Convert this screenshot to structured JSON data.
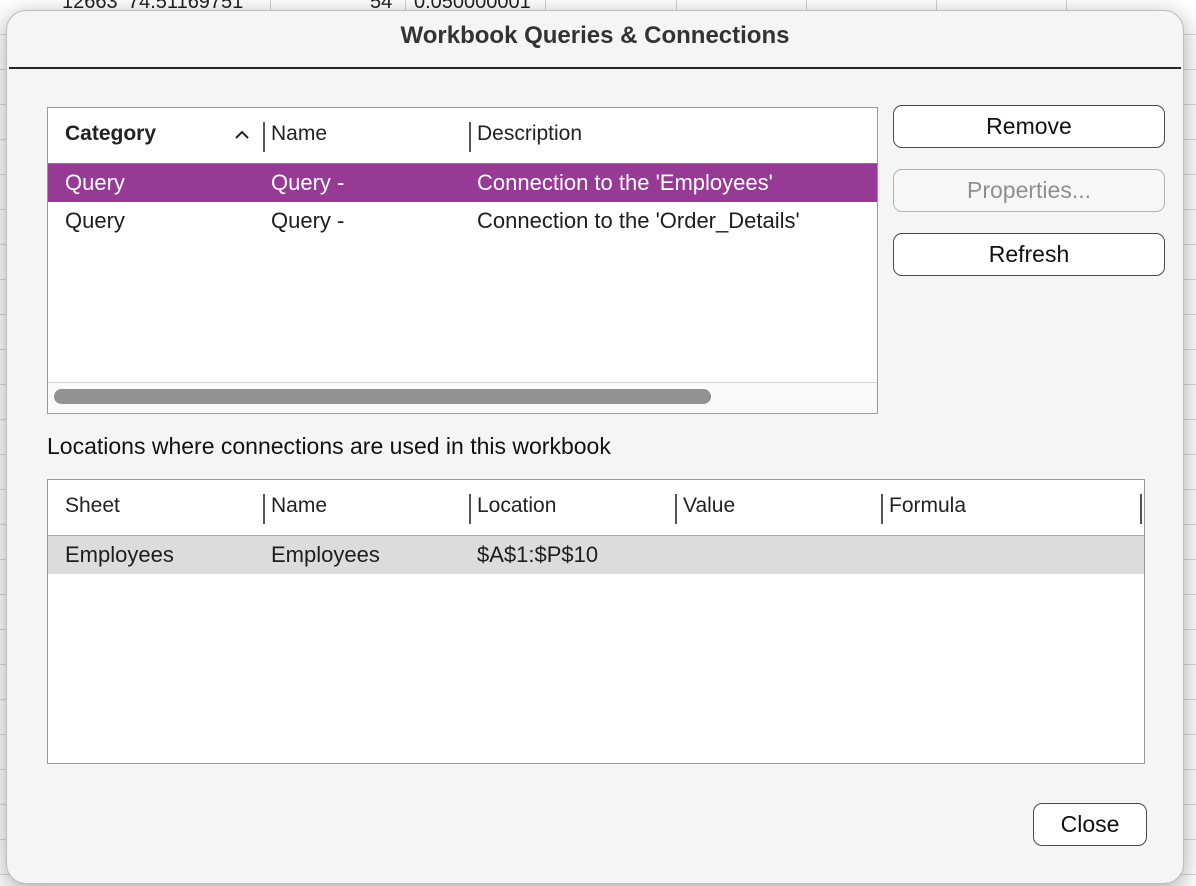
{
  "background": {
    "cells": [
      "12663",
      "74.51169751",
      "54",
      "0.050000001"
    ]
  },
  "dialog": {
    "title": "Workbook Queries & Connections"
  },
  "connections_table": {
    "columns": [
      "Category",
      "Name",
      "Description"
    ],
    "sort_column": "Category",
    "rows": [
      {
        "category": "Query",
        "name": "Query -",
        "description": "Connection to the 'Employees'",
        "selected": true
      },
      {
        "category": "Query",
        "name": "Query -",
        "description": "Connection to the 'Order_Details'",
        "selected": false
      }
    ]
  },
  "buttons": {
    "remove": "Remove",
    "properties": "Properties...",
    "refresh": "Refresh",
    "close": "Close"
  },
  "locations_label": "Locations where connections are used in this workbook",
  "locations_table": {
    "columns": [
      "Sheet",
      "Name",
      "Location",
      "Value",
      "Formula"
    ],
    "rows": [
      {
        "sheet": "Employees",
        "name": "Employees",
        "location": "$A$1:$P$10",
        "value": "",
        "formula": ""
      }
    ]
  },
  "colors": {
    "selection": "#963a96",
    "row_highlight": "#dcdcdc"
  }
}
